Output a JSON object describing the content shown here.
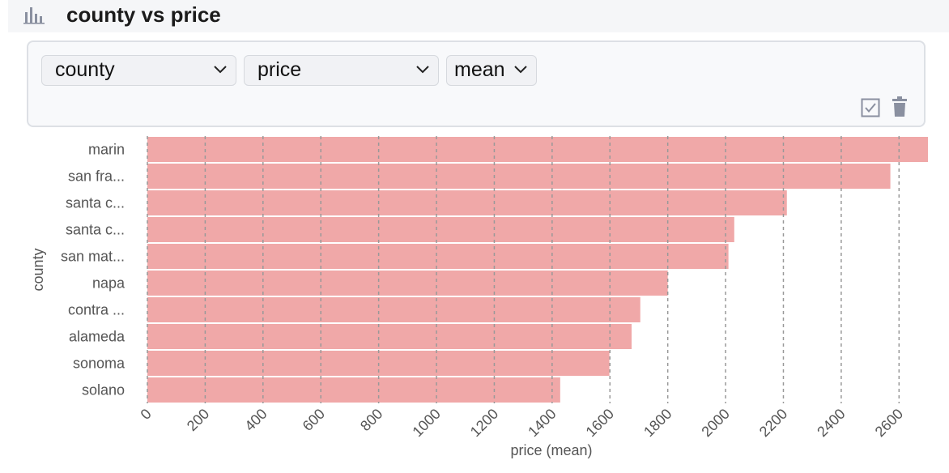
{
  "header": {
    "title": "county vs price",
    "icon": "bar-chart-icon"
  },
  "controls": {
    "x_field": "county",
    "y_field": "price",
    "aggregation": "mean",
    "icons": [
      "checkbox-icon",
      "trash-icon"
    ]
  },
  "colors": {
    "bar": "#f0a8a8",
    "grid": "#999999",
    "header_bg": "#f5f6f8",
    "panel_bg": "#f8f9fb"
  },
  "chart_data": {
    "type": "bar",
    "orientation": "horizontal",
    "categories": [
      "marin",
      "san fra...",
      "santa c...",
      "santa c...",
      "san mat...",
      "napa",
      "contra ...",
      "alameda",
      "sonoma",
      "solano"
    ],
    "values": [
      2700,
      2570,
      2212,
      2030,
      2010,
      1800,
      1705,
      1675,
      1598,
      1428
    ],
    "xlabel": "price (mean)",
    "ylabel": "county",
    "xlim": [
      0,
      2700
    ],
    "xticks": [
      0,
      200,
      400,
      600,
      800,
      1000,
      1200,
      1400,
      1600,
      1800,
      2000,
      2200,
      2400,
      2600
    ],
    "grid": true
  }
}
